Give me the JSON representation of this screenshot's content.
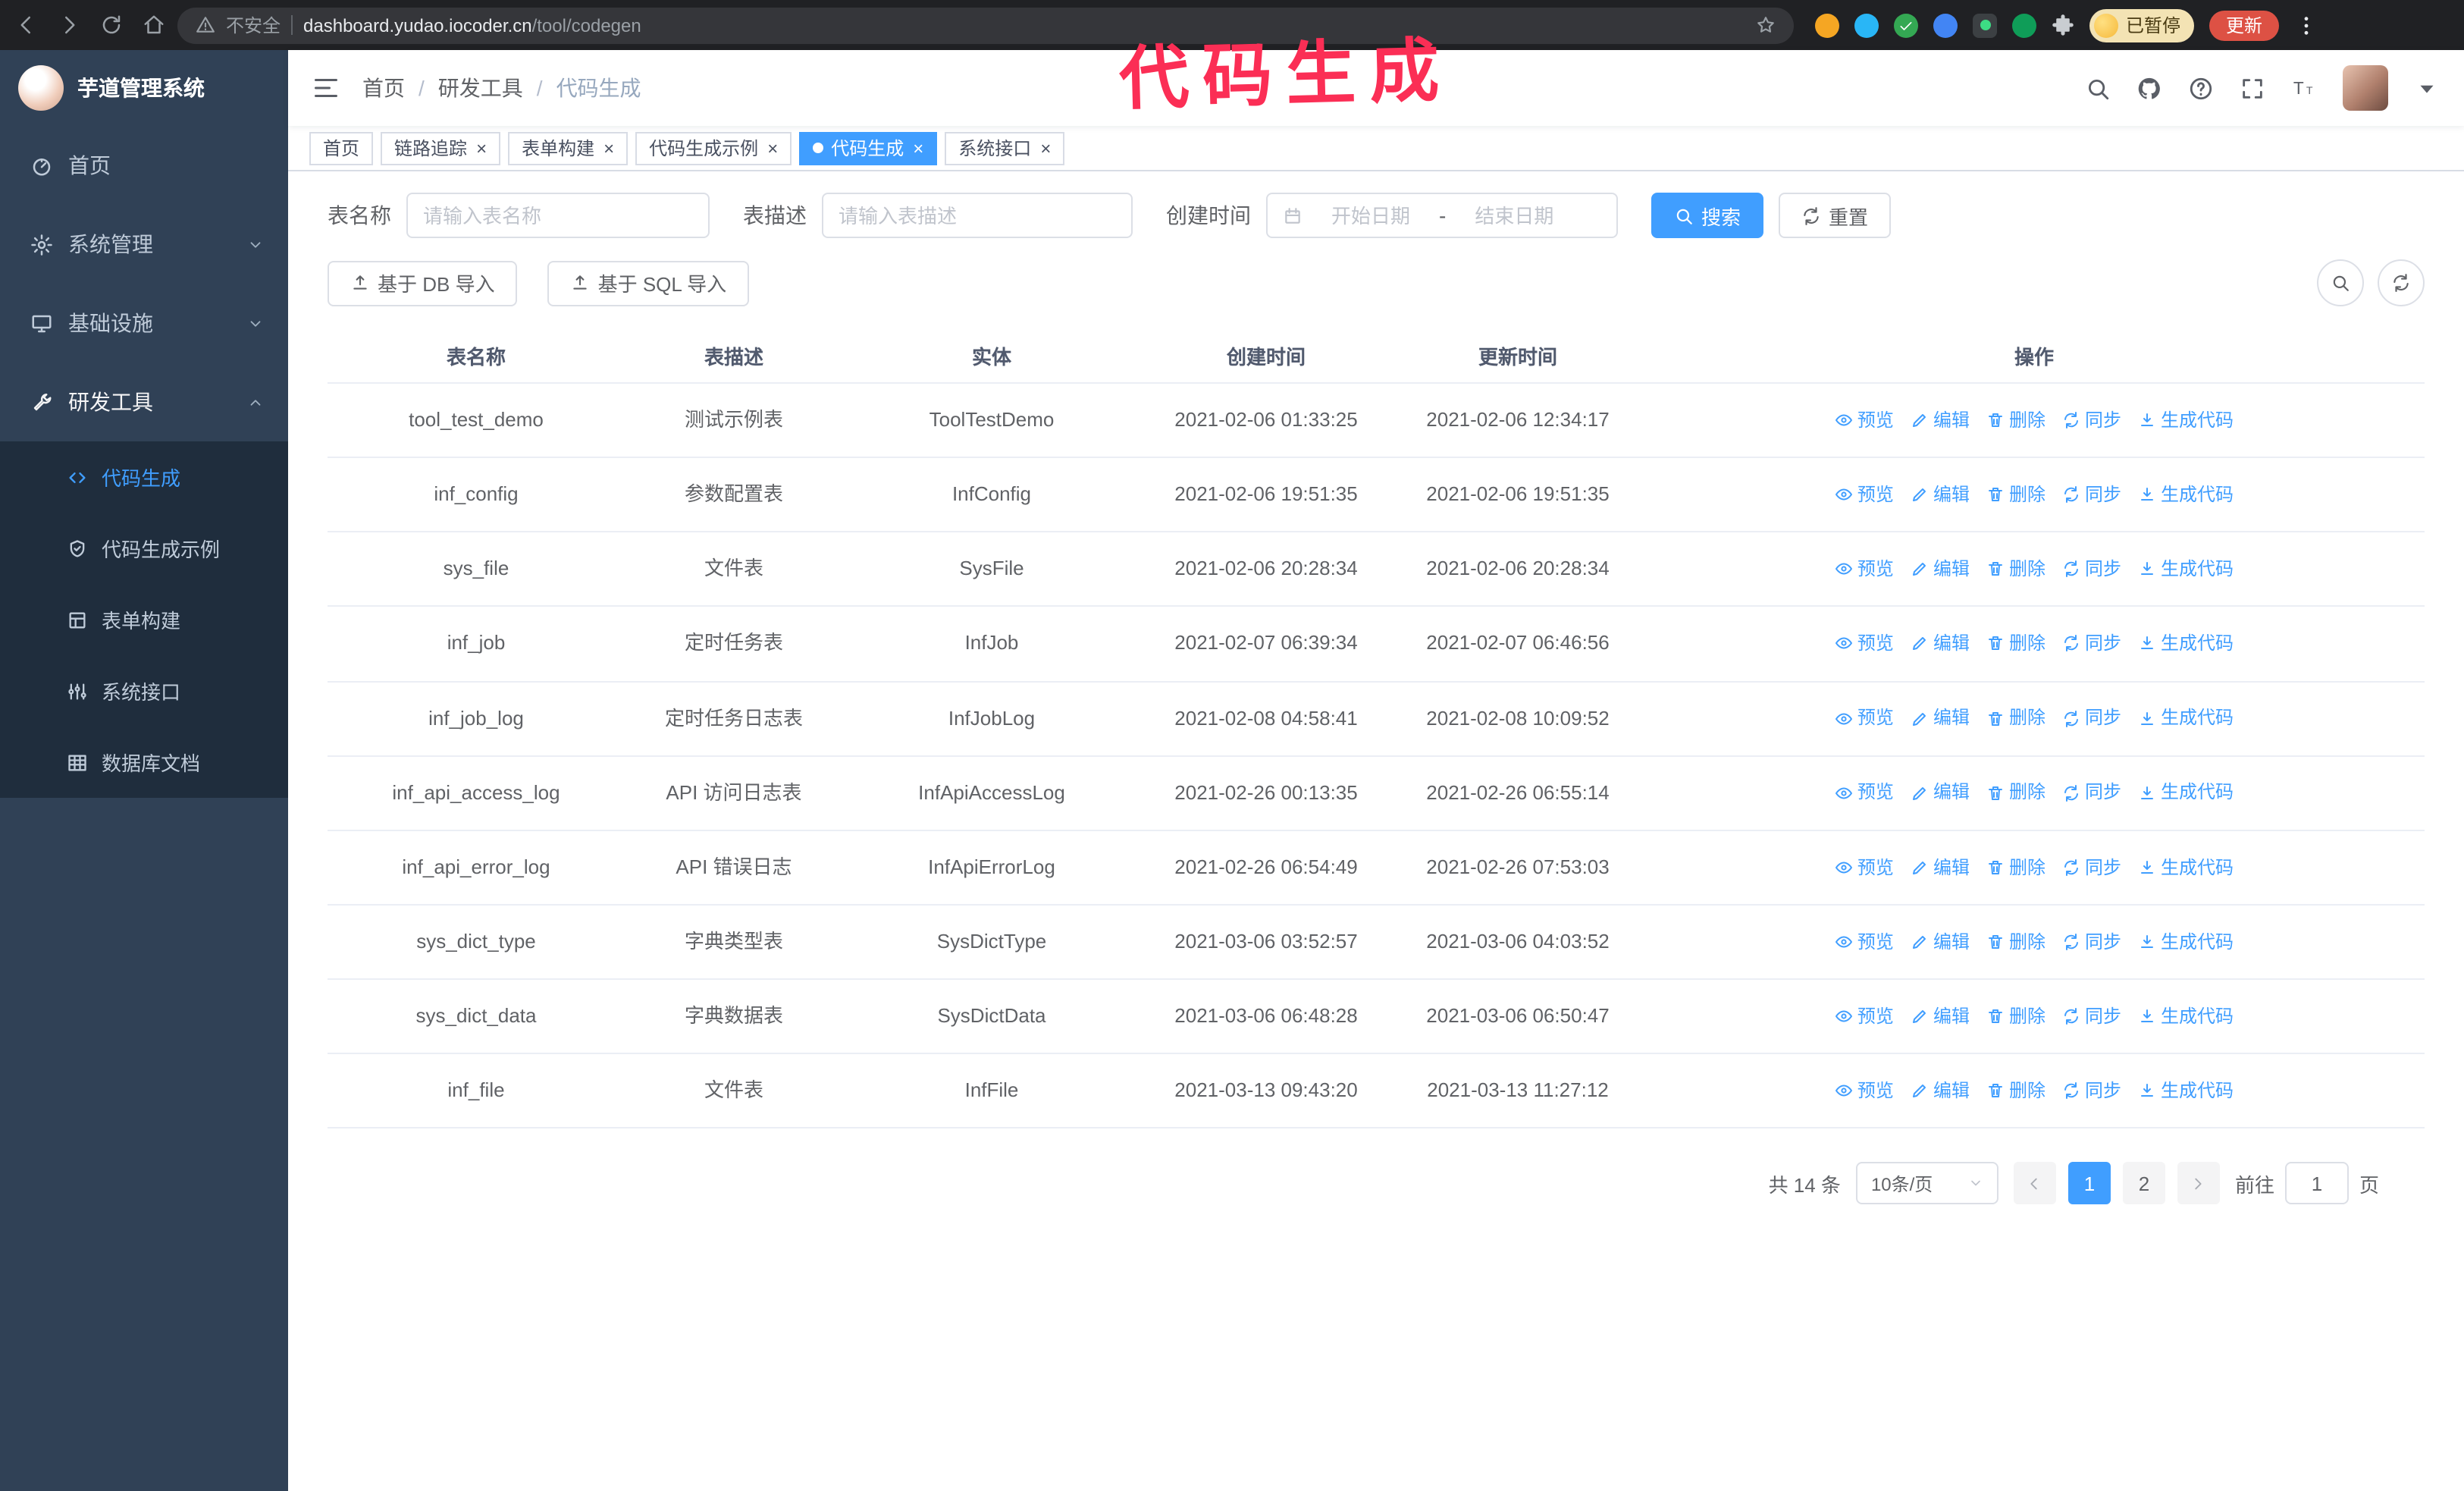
{
  "colors": {
    "accent": "#409eff",
    "update_button": "#dd5144",
    "annotation": "#fb2e55"
  },
  "browser": {
    "security_label": "不安全",
    "url_domain": "dashboard.yudao.iocoder.cn",
    "url_path": "/tool/codegen",
    "paused_label": "已暂停",
    "update_label": "更新"
  },
  "annotation": {
    "text": "代码生成",
    "color": "#fb2e55"
  },
  "sidebar": {
    "logo_title": "芋道管理系统",
    "items": [
      {
        "key": "home",
        "icon": "dashboard-icon",
        "label": "首页"
      },
      {
        "key": "system",
        "icon": "gear-icon",
        "label": "系统管理",
        "chevron": "down"
      },
      {
        "key": "infra",
        "icon": "monitor-icon",
        "label": "基础设施",
        "chevron": "down"
      },
      {
        "key": "devtools",
        "icon": "wrench-icon",
        "label": "研发工具",
        "chevron": "up",
        "expanded": true
      }
    ],
    "subitems": [
      {
        "key": "codegen",
        "icon": "code-icon",
        "label": "代码生成",
        "active": true
      },
      {
        "key": "codegen-example",
        "icon": "shield-check-icon",
        "label": "代码生成示例"
      },
      {
        "key": "form-builder",
        "icon": "form-icon",
        "label": "表单构建"
      },
      {
        "key": "system-api",
        "icon": "sliders-icon",
        "label": "系统接口"
      },
      {
        "key": "db-doc",
        "icon": "table-grid-icon",
        "label": "数据库文档"
      }
    ]
  },
  "header": {
    "breadcrumb": [
      "首页",
      "研发工具",
      "代码生成"
    ],
    "breadcrumb_separator": "/"
  },
  "tabs": [
    {
      "label": "首页",
      "closable": false,
      "active": false
    },
    {
      "label": "链路追踪",
      "closable": true,
      "active": false
    },
    {
      "label": "表单构建",
      "closable": true,
      "active": false
    },
    {
      "label": "代码生成示例",
      "closable": true,
      "active": false
    },
    {
      "label": "代码生成",
      "closable": true,
      "active": true
    },
    {
      "label": "系统接口",
      "closable": true,
      "active": false
    }
  ],
  "filters": {
    "table_name_label": "表名称",
    "table_name_placeholder": "请输入表名称",
    "table_desc_label": "表描述",
    "table_desc_placeholder": "请输入表描述",
    "create_time_label": "创建时间",
    "date_start_placeholder": "开始日期",
    "date_separator": "-",
    "date_end_placeholder": "结束日期",
    "search_button": "搜索",
    "reset_button": "重置"
  },
  "toolbar": {
    "import_db_label": "基于 DB 导入",
    "import_sql_label": "基于 SQL 导入"
  },
  "table": {
    "columns": [
      "表名称",
      "表描述",
      "实体",
      "创建时间",
      "更新时间",
      "操作"
    ],
    "op_labels": [
      "预览",
      "编辑",
      "删除",
      "同步",
      "生成代码"
    ],
    "op_keys": [
      "preview",
      "edit",
      "delete",
      "sync",
      "generate"
    ],
    "rows": [
      {
        "name": "tool_test_demo",
        "desc": "测试示例表",
        "entity": "ToolTestDemo",
        "created": "2021-02-06 01:33:25",
        "updated": "2021-02-06 12:34:17"
      },
      {
        "name": "inf_config",
        "desc": "参数配置表",
        "entity": "InfConfig",
        "created": "2021-02-06 19:51:35",
        "updated": "2021-02-06 19:51:35"
      },
      {
        "name": "sys_file",
        "desc": "文件表",
        "entity": "SysFile",
        "created": "2021-02-06 20:28:34",
        "updated": "2021-02-06 20:28:34"
      },
      {
        "name": "inf_job",
        "desc": "定时任务表",
        "entity": "InfJob",
        "created": "2021-02-07 06:39:34",
        "updated": "2021-02-07 06:46:56"
      },
      {
        "name": "inf_job_log",
        "desc": "定时任务日志表",
        "entity": "InfJobLog",
        "created": "2021-02-08 04:58:41",
        "updated": "2021-02-08 10:09:52"
      },
      {
        "name": "inf_api_access_log",
        "desc": "API 访问日志表",
        "entity": "InfApiAccessLog",
        "created": "2021-02-26 00:13:35",
        "updated": "2021-02-26 06:55:14"
      },
      {
        "name": "inf_api_error_log",
        "desc": "API 错误日志",
        "entity": "InfApiErrorLog",
        "created": "2021-02-26 06:54:49",
        "updated": "2021-02-26 07:53:03"
      },
      {
        "name": "sys_dict_type",
        "desc": "字典类型表",
        "entity": "SysDictType",
        "created": "2021-03-06 03:52:57",
        "updated": "2021-03-06 04:03:52"
      },
      {
        "name": "sys_dict_data",
        "desc": "字典数据表",
        "entity": "SysDictData",
        "created": "2021-03-06 06:48:28",
        "updated": "2021-03-06 06:50:47"
      },
      {
        "name": "inf_file",
        "desc": "文件表",
        "entity": "InfFile",
        "created": "2021-03-13 09:43:20",
        "updated": "2021-03-13 11:27:12"
      }
    ]
  },
  "pagination": {
    "total_text": "共 14 条",
    "page_size_label": "10条/页",
    "pages": [
      "1",
      "2"
    ],
    "active_page": "1",
    "goto_label": "前往",
    "goto_value": "1",
    "goto_unit": "页"
  }
}
